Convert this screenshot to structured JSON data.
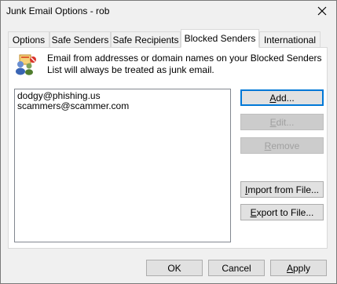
{
  "window": {
    "title": "Junk Email Options - rob"
  },
  "tabs": [
    {
      "label": "Options"
    },
    {
      "label": "Safe Senders"
    },
    {
      "label": "Safe Recipients"
    },
    {
      "label": "Blocked Senders"
    },
    {
      "label": "International"
    }
  ],
  "active_tab": "Blocked Senders",
  "description": "Email from addresses or domain names on your Blocked Senders List will always be treated as junk email.",
  "blocked_list": [
    "dodgy@phishing.us",
    "scammers@scammer.com"
  ],
  "side_buttons": {
    "add": {
      "pre": "",
      "key": "A",
      "post": "dd..."
    },
    "edit": {
      "pre": "",
      "key": "E",
      "post": "dit..."
    },
    "remove": {
      "pre": "",
      "key": "R",
      "post": "emove"
    },
    "import": {
      "pre": "",
      "key": "I",
      "post": "mport from File..."
    },
    "export": {
      "pre": "",
      "key": "E",
      "post": "xport to File..."
    }
  },
  "footer": {
    "ok": "OK",
    "cancel": "Cancel",
    "apply_key": "A",
    "apply_rest": "pply"
  }
}
